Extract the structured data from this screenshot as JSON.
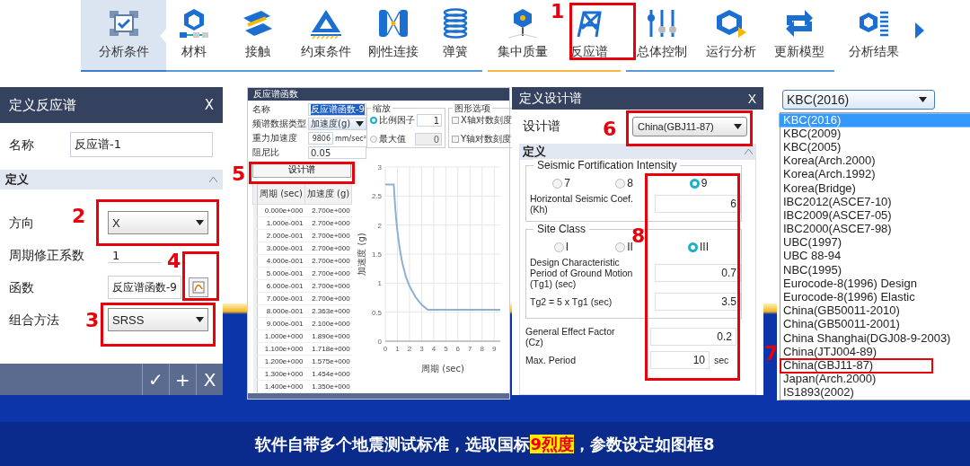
{
  "toolbar": {
    "items": [
      {
        "label": "分析条件",
        "selected": true
      },
      {
        "label": "材料",
        "selected": false
      },
      {
        "label": "接触",
        "selected": false
      },
      {
        "label": "约束条件",
        "selected": false
      },
      {
        "label": "刚性连接",
        "selected": false
      },
      {
        "label": "弹簧",
        "selected": false
      },
      {
        "label": "集中质量",
        "selected": false
      },
      {
        "label": "反应谱",
        "selected": false
      },
      {
        "label": "总体控制",
        "selected": false
      },
      {
        "label": "运行分析",
        "selected": false
      },
      {
        "label": "更新模型",
        "selected": false
      },
      {
        "label": "分析结果",
        "selected": false
      }
    ]
  },
  "response_panel": {
    "title": "定义反应谱",
    "close": "X",
    "name_label": "名称",
    "name": "反应谱-1",
    "section": "定义",
    "rows": [
      {
        "kind": "dropdown",
        "label": "方向",
        "value": "X"
      },
      {
        "kind": "field",
        "label": "周期修正系数",
        "value": "1"
      },
      {
        "kind": "function",
        "label": "函数",
        "value": "反应谱函数-9"
      },
      {
        "kind": "dropdown",
        "label": "组合方法",
        "value": "SRSS"
      }
    ],
    "footer_buttons": [
      "✓",
      "+",
      "X"
    ]
  },
  "function_panel": {
    "title": "反应谱函数",
    "form": [
      {
        "kind": "field",
        "label": "名称",
        "value": "反应谱函数-9",
        "text_selected": true
      },
      {
        "kind": "dropdown",
        "label": "频谱数据类型",
        "value": "加速度(g)",
        "text_selected": false
      },
      {
        "kind": "field",
        "label": "重力加速度",
        "value": "9806",
        "unit": "mm/sec²",
        "text_selected": false
      },
      {
        "kind": "field",
        "label": "阻尼比",
        "value": "0.05",
        "text_selected": false
      }
    ],
    "scale": {
      "legend": "缩放",
      "options": [
        {
          "label": "比例因子",
          "selected": true,
          "value": "1"
        },
        {
          "label": "最大值",
          "selected": false,
          "value": "0"
        }
      ]
    },
    "graph_options": {
      "legend": "图形选项",
      "options": [
        {
          "label": "X轴对数刻度",
          "checked": false
        },
        {
          "label": "Y轴对数刻度",
          "checked": false
        }
      ]
    },
    "design_button": "设计谱",
    "table": {
      "columns": [
        "周期 (sec)",
        "加速度 (g)"
      ],
      "rows": [
        [
          "0.000e+000",
          "2.700e+000"
        ],
        [
          "1.000e-001",
          "2.700e+000"
        ],
        [
          "2.000e-001",
          "2.700e+000"
        ],
        [
          "3.000e-001",
          "2.700e+000"
        ],
        [
          "4.000e-001",
          "2.700e+000"
        ],
        [
          "5.000e-001",
          "2.700e+000"
        ],
        [
          "6.000e-001",
          "2.700e+000"
        ],
        [
          "7.000e-001",
          "2.700e+000"
        ],
        [
          "8.000e-001",
          "2.363e+000"
        ],
        [
          "9.000e-001",
          "2.100e+000"
        ],
        [
          "1.000e+000",
          "1.890e+000"
        ],
        [
          "1.100e+000",
          "1.718e+000"
        ],
        [
          "1.200e+000",
          "1.575e+000"
        ],
        [
          "1.300e+000",
          "1.454e+000"
        ],
        [
          "1.400e+000",
          "1.350e+000"
        ]
      ]
    },
    "chart": {
      "chart_data": {
        "type": "line",
        "xlabel": "周期 (sec)",
        "ylabel": "加速度 (g)",
        "x": [
          0,
          0.7,
          0.8,
          0.9,
          1,
          1.2,
          1.4,
          1.7,
          2,
          2.5,
          3,
          3.5,
          9.5
        ],
        "series": [
          {
            "color": "#8fb0cf",
            "values": [
              2.7,
              2.7,
              2.36,
              2.1,
              1.89,
              1.58,
              1.35,
              1.11,
              0.95,
              0.76,
              0.63,
              0.54,
              0.54
            ]
          }
        ],
        "grid": true,
        "xlim": [
          0,
          9.5
        ],
        "ylim": [
          0,
          3
        ],
        "xticks": [
          0,
          1,
          2,
          3,
          4,
          5,
          6,
          7,
          8,
          9
        ],
        "yticks": [
          0,
          0.5,
          1,
          1.5,
          2,
          2.5,
          3
        ]
      }
    }
  },
  "design_panel": {
    "title": "定义设计谱",
    "close": "X",
    "spectrum_label": "设计谱",
    "spectrum": "China(GBJ11-87)",
    "section": "定义",
    "intensity": {
      "legend": "Seismic Fortification Intensity",
      "options": [
        {
          "label": "7",
          "selected": false
        },
        {
          "label": "8",
          "selected": false
        },
        {
          "label": "9",
          "selected": true
        }
      ],
      "coef_label": "Horizontal Seismic Coef. (Kh)",
      "coef": "6"
    },
    "site": {
      "legend": "Site Class",
      "options": [
        {
          "label": "I",
          "selected": false
        },
        {
          "label": "II",
          "selected": false
        },
        {
          "label": "III",
          "selected": true
        }
      ],
      "tg1_label": "Design Characteristic Period of Ground Motion (Tg1) (sec)",
      "tg1": "0.7",
      "tg2_label": "Tg2 = 5 x Tg1 (sec)",
      "tg2": "3.5"
    },
    "cz_label": "General Effect Factor (Cz)",
    "cz": "0.2",
    "max_label": "Max. Period",
    "max": "10",
    "max_unit": "sec"
  },
  "code_list": {
    "value": "KBC(2016)",
    "items": [
      {
        "label": "KBC(2016)",
        "selected": true
      },
      {
        "label": "KBC(2009)",
        "selected": false
      },
      {
        "label": "KBC(2005)",
        "selected": false
      },
      {
        "label": "Korea(Arch.2000)",
        "selected": false
      },
      {
        "label": "Korea(Arch.1992)",
        "selected": false
      },
      {
        "label": "Korea(Bridge)",
        "selected": false
      },
      {
        "label": "IBC2012(ASCE7-10)",
        "selected": false
      },
      {
        "label": "IBC2009(ASCE7-05)",
        "selected": false
      },
      {
        "label": "IBC2000(ASCE7-98)",
        "selected": false
      },
      {
        "label": "UBC(1997)",
        "selected": false
      },
      {
        "label": "UBC 88-94",
        "selected": false
      },
      {
        "label": "NBC(1995)",
        "selected": false
      },
      {
        "label": "Eurocode-8(1996) Design",
        "selected": false
      },
      {
        "label": "Eurocode-8(1996) Elastic",
        "selected": false
      },
      {
        "label": "China(GB50011-2010)",
        "selected": false
      },
      {
        "label": "China(GB50011-2001)",
        "selected": false
      },
      {
        "label": "China Shanghai(DGJ08-9-2003)",
        "selected": false
      },
      {
        "label": "China(JTJ004-89)",
        "selected": false
      },
      {
        "label": "China(GBJ11-87)",
        "selected": false
      },
      {
        "label": "Japan(Arch.2000)",
        "selected": false
      },
      {
        "label": "IS1893(2002)",
        "selected": false
      }
    ]
  },
  "annotations": [
    "1",
    "2",
    "3",
    "4",
    "5",
    "6",
    "7",
    "8"
  ],
  "caption": "软件自带多个地震测试标准，选取国标**9烈度**，参数设定如图框8"
}
